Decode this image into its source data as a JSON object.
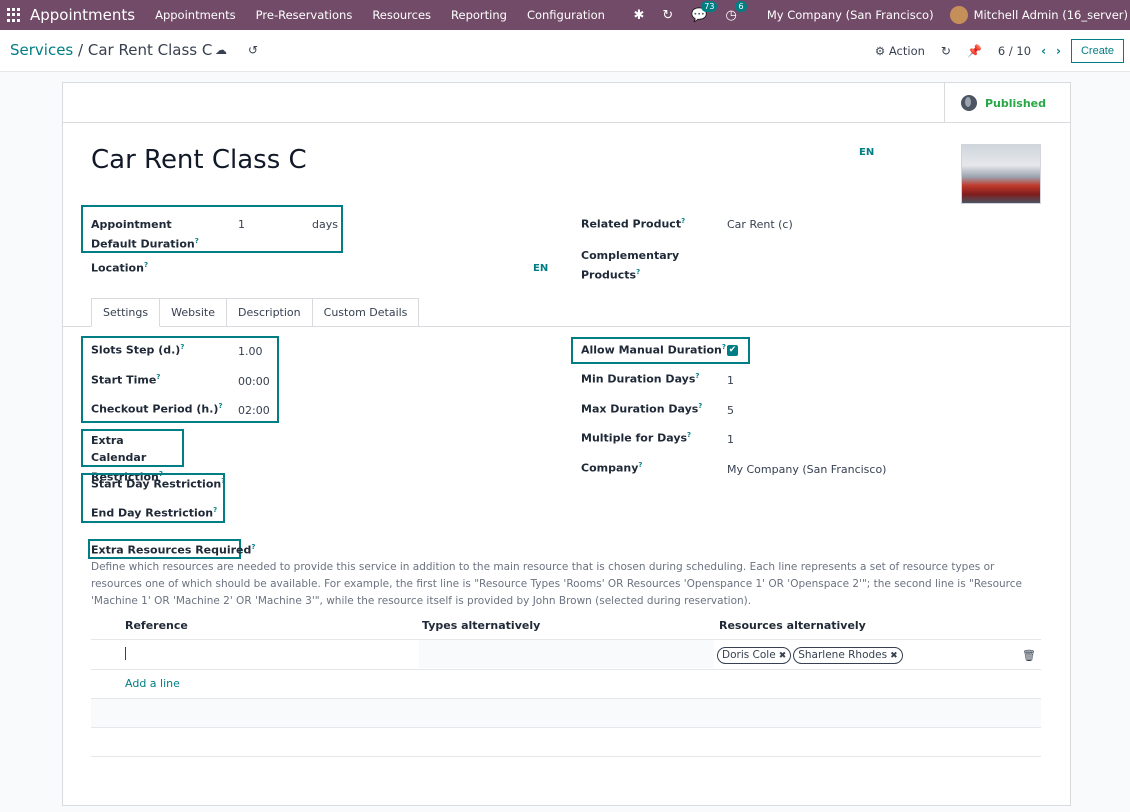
{
  "navbar": {
    "brand": "Appointments",
    "menu": [
      "Appointments",
      "Pre-Reservations",
      "Resources",
      "Reporting",
      "Configuration"
    ],
    "messages_count": "73",
    "activities_count": "6",
    "company": "My Company (San Francisco)",
    "user": "Mitchell Admin (16_server)"
  },
  "control": {
    "breadcrumb_parent": "Services",
    "breadcrumb_sep": "/",
    "breadcrumb_current": "Car Rent Class C",
    "action_label": "Action",
    "pager": "6 / 10",
    "create_label": "Create"
  },
  "sheet": {
    "published_label": "Published",
    "title": "Car Rent Class C",
    "lang": "EN",
    "fields": {
      "default_duration_label": "Appointment Default Duration",
      "default_duration_value": "1",
      "default_duration_unit": "days",
      "location_label": "Location",
      "related_product_label": "Related Product",
      "related_product_value": "Car Rent (c)",
      "complementary_label": "Complementary Products"
    },
    "tabs": [
      "Settings",
      "Website",
      "Description",
      "Custom Details"
    ],
    "settings": {
      "slots_step_label": "Slots Step (d.)",
      "slots_step_value": "1.00",
      "start_time_label": "Start Time",
      "start_time_value": "00:00",
      "checkout_label": "Checkout Period (h.)",
      "checkout_value": "02:00",
      "extra_calendar_label": "Extra Calendar Restriction",
      "start_day_label": "Start Day Restriction",
      "end_day_label": "End Day Restriction",
      "allow_manual_label": "Allow Manual Duration",
      "allow_manual_checked": true,
      "min_days_label": "Min Duration Days",
      "min_days_value": "1",
      "max_days_label": "Max Duration Days",
      "max_days_value": "5",
      "multiple_days_label": "Multiple for Days",
      "multiple_days_value": "1",
      "company_label": "Company",
      "company_value": "My Company (San Francisco)"
    },
    "extra_resources": {
      "label": "Extra Resources Required",
      "description": "Define which resources are needed to provide this service in addition to the main resource that is chosen during scheduling. Each line represents a set of resource types or resources one of which should be available. For example, the first line is \"Resource Types 'Rooms' OR Resources 'Openspance 1' OR 'Openspace 2'\"; the second line is \"Resource 'Machine 1' OR 'Machine 2' OR 'Machine 3'\", while the resource itself is provided by John Brown (selected during reservation).",
      "columns": [
        "Reference",
        "Types alternatively",
        "Resources alternatively"
      ],
      "tags": [
        "Doris Cole",
        "Sharlene Rhodes"
      ],
      "add_line": "Add a line"
    }
  }
}
